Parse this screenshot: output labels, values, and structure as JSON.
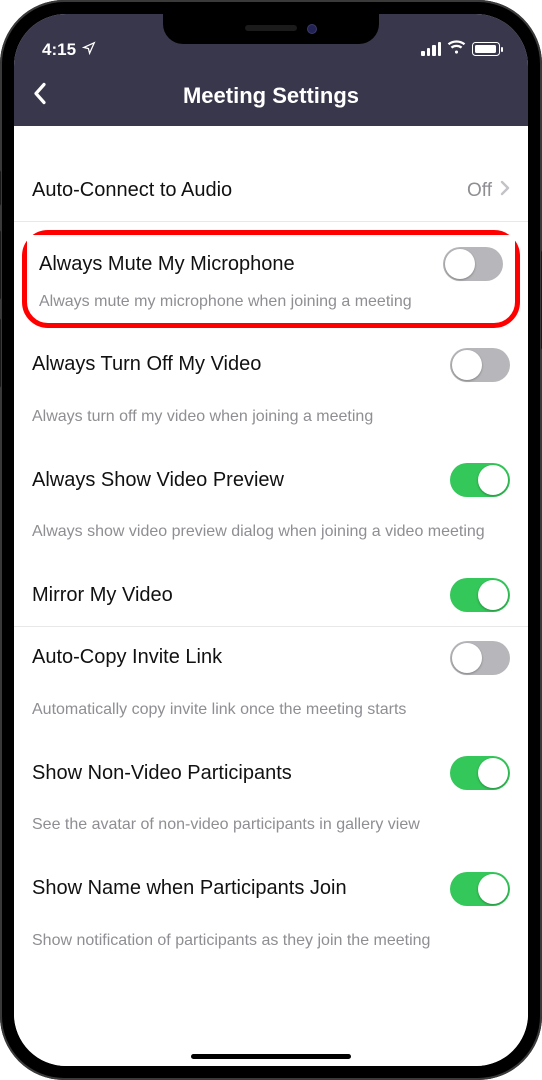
{
  "status": {
    "time": "4:15"
  },
  "header": {
    "title": "Meeting Settings"
  },
  "rows": {
    "autoConnect": {
      "label": "Auto-Connect to Audio",
      "value": "Off"
    },
    "muteMic": {
      "label": "Always Mute My Microphone",
      "desc": "Always mute my microphone when joining a meeting"
    },
    "offVideo": {
      "label": "Always Turn Off My Video",
      "desc": "Always turn off my video when joining a meeting"
    },
    "preview": {
      "label": "Always Show Video Preview",
      "desc": "Always show video preview dialog when joining a video meeting"
    },
    "mirror": {
      "label": "Mirror My Video"
    },
    "copyLink": {
      "label": "Auto-Copy Invite Link",
      "desc": "Automatically copy invite link once the meeting starts"
    },
    "nonVideo": {
      "label": "Show Non-Video Participants",
      "desc": "See the avatar of non-video participants in gallery view"
    },
    "showName": {
      "label": "Show Name when Participants Join",
      "desc": "Show notification of participants as they join the meeting"
    }
  }
}
